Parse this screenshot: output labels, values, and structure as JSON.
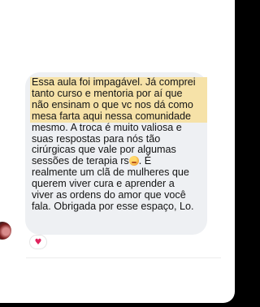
{
  "message": {
    "lines_highlighted": [
      "Essa aula foi impagável. Já comprei",
      "tanto curso e mentoria por aí que",
      "não ensinam o que vc nos dá como",
      "mesa farta aqui nessa comunidade"
    ],
    "lines_normal": [
      "mesmo. A troca é muito valiosa e",
      "suas respostas para nós tão",
      "cirúrgicas que vale por algumas"
    ],
    "line_with_emoji_before": "sessões de terapia rs",
    "line_with_emoji_after": ".  É",
    "lines_tail": [
      "realmente um clã de mulheres que",
      "querem viver cura e aprender a",
      "viver as ordens do amor que você",
      "fala. Obrigada por esse espaço, Lo."
    ],
    "emoji_icon": "exploding-head-emoji",
    "highlight_color": "#f6e2a8",
    "bubble_color": "#eef0f3"
  },
  "reaction": {
    "glyph": "♥",
    "icon": "heart-icon",
    "color": "#e0245e"
  },
  "avatar": {
    "icon": "avatar"
  }
}
